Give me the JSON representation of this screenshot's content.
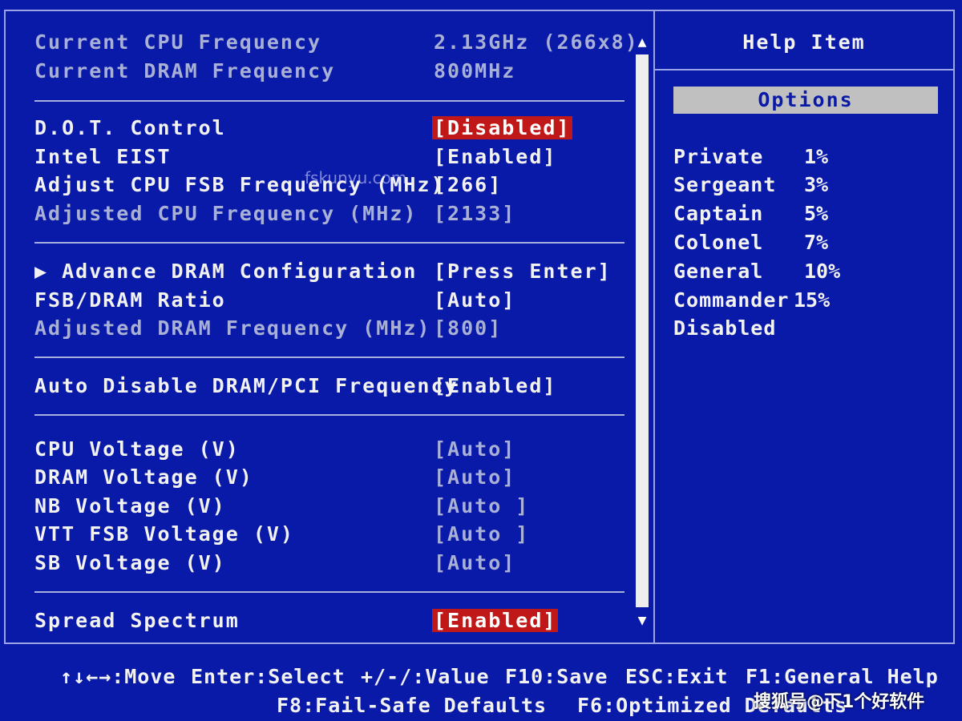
{
  "info": {
    "cpu_freq_label": "Current CPU Frequency",
    "cpu_freq_value": "2.13GHz (266x8)",
    "dram_freq_label": "Current DRAM Frequency",
    "dram_freq_value": "800MHz"
  },
  "settings": {
    "dot_control_label": "D.O.T. Control",
    "dot_control_value": "[Disabled]",
    "eist_label": "Intel EIST",
    "eist_value": "[Enabled]",
    "fsb_freq_label": "Adjust CPU FSB Frequency (MHz)",
    "fsb_freq_value": "[266]",
    "adj_cpu_label": "Adjusted CPU Frequency (MHz)",
    "adj_cpu_value": "[2133]",
    "adv_dram_label": "▶ Advance DRAM Configuration",
    "adv_dram_value": "[Press Enter]",
    "fsb_dram_ratio_label": "FSB/DRAM Ratio",
    "fsb_dram_ratio_value": "[Auto]",
    "adj_dram_label": "Adjusted DRAM Frequency (MHz)",
    "adj_dram_value": "[800]",
    "auto_disable_label": "Auto Disable DRAM/PCI Frequency",
    "auto_disable_value": "[Enabled]",
    "cpu_volt_label": "CPU Voltage (V)",
    "cpu_volt_value": "[Auto]",
    "dram_volt_label": "DRAM Voltage (V)",
    "dram_volt_value": "[Auto]",
    "nb_volt_label": "NB Voltage (V)",
    "nb_volt_value": "[Auto ]",
    "vtt_volt_label": "VTT FSB Voltage (V)",
    "vtt_volt_value": "[Auto ]",
    "sb_volt_label": "SB Voltage (V)",
    "sb_volt_value": "[Auto]",
    "spread_label": "Spread Spectrum",
    "spread_value": "[Enabled]"
  },
  "help": {
    "title": "Help Item",
    "options_label": "Options",
    "options": [
      {
        "name": "Private",
        "pct": "1%"
      },
      {
        "name": "Sergeant",
        "pct": "3%"
      },
      {
        "name": "Captain",
        "pct": "5%"
      },
      {
        "name": "Colonel",
        "pct": "7%"
      },
      {
        "name": "General",
        "pct": "10%"
      },
      {
        "name": "Commander",
        "pct": "15%"
      },
      {
        "name": "Disabled",
        "pct": ""
      }
    ]
  },
  "footer": {
    "move": "↑↓←→:Move",
    "select": "Enter:Select",
    "value": "+/-/:Value",
    "save": "F10:Save",
    "exit": "ESC:Exit",
    "help": "F1:General Help",
    "failsafe": "F8:Fail-Safe Defaults",
    "optimized": "F6:Optimized Defaults"
  },
  "watermarks": {
    "site": "fskunyu.com",
    "corner": "搜狐号@下1个好软件"
  },
  "colors": {
    "background": "#0a1aa8",
    "highlight": "#c01818",
    "dim_text": "#a9b0d6"
  }
}
